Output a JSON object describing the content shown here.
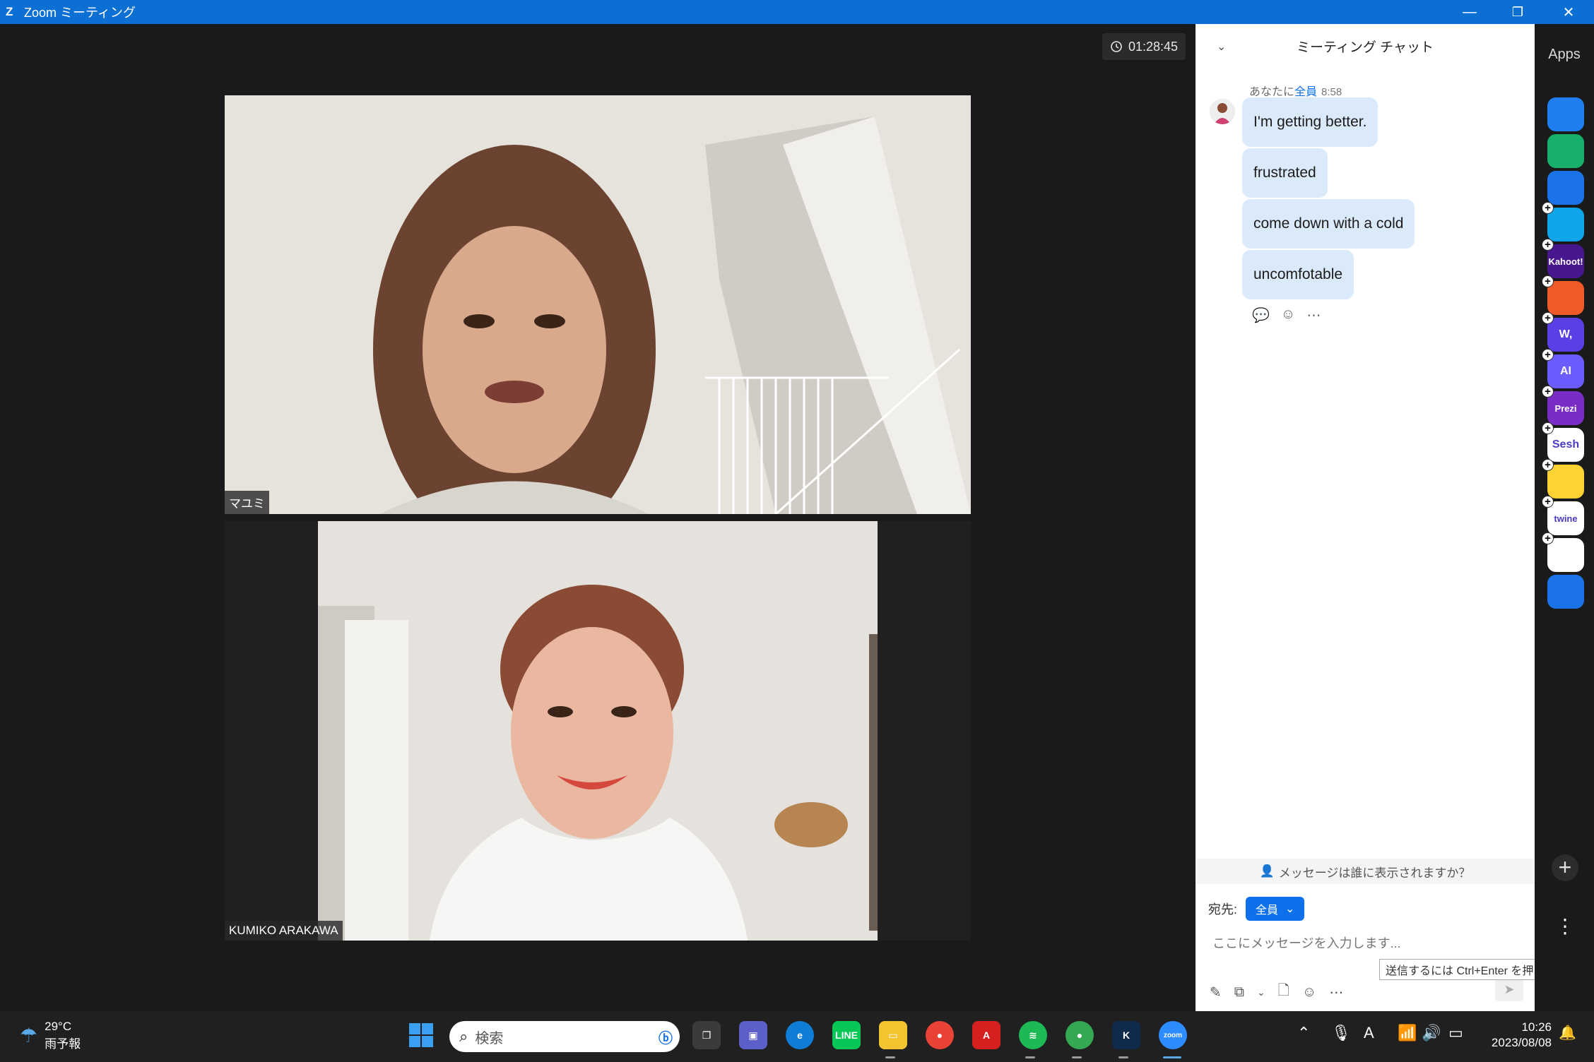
{
  "window": {
    "title": "Zoom ミーティング",
    "minimize_glyph": "—",
    "restore_glyph": "❐",
    "close_glyph": "✕"
  },
  "meeting": {
    "elapsed_time": "01:28:45",
    "participants": [
      {
        "name": "マユミ"
      },
      {
        "name": "KUMIKO ARAKAWA"
      }
    ]
  },
  "chat": {
    "title": "ミーティング チャット",
    "sender_prefix": "あなたに",
    "sender_to": "全員",
    "sent_time": "8:58",
    "messages": [
      "I'm getting better.",
      "frustrated",
      "come down with a cold",
      "uncomfotable"
    ],
    "who_sees_prompt": "メッセージは誰に表示されますか？",
    "to_label": "宛先:",
    "to_value": "全員",
    "input_placeholder": "ここにメッセージを入力します...",
    "send_tooltip": "送信するには Ctrl+Enter を押してください"
  },
  "apps_sidebar": {
    "title": "Apps",
    "items": [
      {
        "name": "smiley-app",
        "label": "",
        "color": "#1f7ff0"
      },
      {
        "name": "p-app",
        "label": "",
        "color": "#16b06a"
      },
      {
        "name": "timer-app",
        "label": "",
        "color": "#1a73e8"
      },
      {
        "name": "flag-app",
        "label": "",
        "color": "#0ea5e9"
      },
      {
        "name": "kahoot-app",
        "label": "Kahoot!",
        "color": "#46178f"
      },
      {
        "name": "c-app",
        "label": "",
        "color": "#f05a28"
      },
      {
        "name": "w-app",
        "label": "W,",
        "color": "#5b3ee6"
      },
      {
        "name": "ai-app",
        "label": "AI",
        "color": "#6a5cff"
      },
      {
        "name": "prezi-app",
        "label": "Prezi",
        "color": "#7a2cc7"
      },
      {
        "name": "sesh-app",
        "label": "Sesh",
        "color": "#ffffff"
      },
      {
        "name": "emoji-app",
        "label": "",
        "color": "#ffd234"
      },
      {
        "name": "twine-app",
        "label": "twine",
        "color": "#ffffff"
      },
      {
        "name": "grid-app",
        "label": "",
        "color": "#ffffff"
      },
      {
        "name": "stopwatch-app",
        "label": "",
        "color": "#1a73e8"
      }
    ]
  },
  "taskbar": {
    "temperature": "29°C",
    "weather": "雨予報",
    "search_placeholder": "検索",
    "zoom_label": "zoom",
    "time": "10:26",
    "date": "2023/08/08",
    "ime_indicator": "A"
  }
}
